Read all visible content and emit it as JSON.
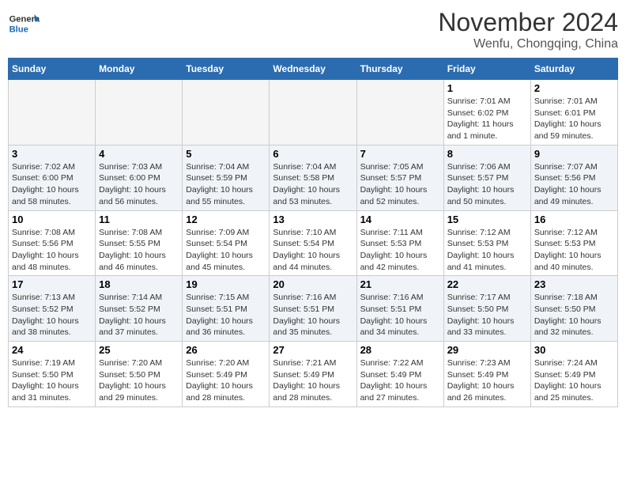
{
  "header": {
    "logo_general": "General",
    "logo_blue": "Blue",
    "month_title": "November 2024",
    "subtitle": "Wenfu, Chongqing, China"
  },
  "weekdays": [
    "Sunday",
    "Monday",
    "Tuesday",
    "Wednesday",
    "Thursday",
    "Friday",
    "Saturday"
  ],
  "weeks": [
    [
      {
        "day": "",
        "info": ""
      },
      {
        "day": "",
        "info": ""
      },
      {
        "day": "",
        "info": ""
      },
      {
        "day": "",
        "info": ""
      },
      {
        "day": "",
        "info": ""
      },
      {
        "day": "1",
        "info": "Sunrise: 7:01 AM\nSunset: 6:02 PM\nDaylight: 11 hours and 1 minute."
      },
      {
        "day": "2",
        "info": "Sunrise: 7:01 AM\nSunset: 6:01 PM\nDaylight: 10 hours and 59 minutes."
      }
    ],
    [
      {
        "day": "3",
        "info": "Sunrise: 7:02 AM\nSunset: 6:00 PM\nDaylight: 10 hours and 58 minutes."
      },
      {
        "day": "4",
        "info": "Sunrise: 7:03 AM\nSunset: 6:00 PM\nDaylight: 10 hours and 56 minutes."
      },
      {
        "day": "5",
        "info": "Sunrise: 7:04 AM\nSunset: 5:59 PM\nDaylight: 10 hours and 55 minutes."
      },
      {
        "day": "6",
        "info": "Sunrise: 7:04 AM\nSunset: 5:58 PM\nDaylight: 10 hours and 53 minutes."
      },
      {
        "day": "7",
        "info": "Sunrise: 7:05 AM\nSunset: 5:57 PM\nDaylight: 10 hours and 52 minutes."
      },
      {
        "day": "8",
        "info": "Sunrise: 7:06 AM\nSunset: 5:57 PM\nDaylight: 10 hours and 50 minutes."
      },
      {
        "day": "9",
        "info": "Sunrise: 7:07 AM\nSunset: 5:56 PM\nDaylight: 10 hours and 49 minutes."
      }
    ],
    [
      {
        "day": "10",
        "info": "Sunrise: 7:08 AM\nSunset: 5:56 PM\nDaylight: 10 hours and 48 minutes."
      },
      {
        "day": "11",
        "info": "Sunrise: 7:08 AM\nSunset: 5:55 PM\nDaylight: 10 hours and 46 minutes."
      },
      {
        "day": "12",
        "info": "Sunrise: 7:09 AM\nSunset: 5:54 PM\nDaylight: 10 hours and 45 minutes."
      },
      {
        "day": "13",
        "info": "Sunrise: 7:10 AM\nSunset: 5:54 PM\nDaylight: 10 hours and 44 minutes."
      },
      {
        "day": "14",
        "info": "Sunrise: 7:11 AM\nSunset: 5:53 PM\nDaylight: 10 hours and 42 minutes."
      },
      {
        "day": "15",
        "info": "Sunrise: 7:12 AM\nSunset: 5:53 PM\nDaylight: 10 hours and 41 minutes."
      },
      {
        "day": "16",
        "info": "Sunrise: 7:12 AM\nSunset: 5:53 PM\nDaylight: 10 hours and 40 minutes."
      }
    ],
    [
      {
        "day": "17",
        "info": "Sunrise: 7:13 AM\nSunset: 5:52 PM\nDaylight: 10 hours and 38 minutes."
      },
      {
        "day": "18",
        "info": "Sunrise: 7:14 AM\nSunset: 5:52 PM\nDaylight: 10 hours and 37 minutes."
      },
      {
        "day": "19",
        "info": "Sunrise: 7:15 AM\nSunset: 5:51 PM\nDaylight: 10 hours and 36 minutes."
      },
      {
        "day": "20",
        "info": "Sunrise: 7:16 AM\nSunset: 5:51 PM\nDaylight: 10 hours and 35 minutes."
      },
      {
        "day": "21",
        "info": "Sunrise: 7:16 AM\nSunset: 5:51 PM\nDaylight: 10 hours and 34 minutes."
      },
      {
        "day": "22",
        "info": "Sunrise: 7:17 AM\nSunset: 5:50 PM\nDaylight: 10 hours and 33 minutes."
      },
      {
        "day": "23",
        "info": "Sunrise: 7:18 AM\nSunset: 5:50 PM\nDaylight: 10 hours and 32 minutes."
      }
    ],
    [
      {
        "day": "24",
        "info": "Sunrise: 7:19 AM\nSunset: 5:50 PM\nDaylight: 10 hours and 31 minutes."
      },
      {
        "day": "25",
        "info": "Sunrise: 7:20 AM\nSunset: 5:50 PM\nDaylight: 10 hours and 29 minutes."
      },
      {
        "day": "26",
        "info": "Sunrise: 7:20 AM\nSunset: 5:49 PM\nDaylight: 10 hours and 28 minutes."
      },
      {
        "day": "27",
        "info": "Sunrise: 7:21 AM\nSunset: 5:49 PM\nDaylight: 10 hours and 28 minutes."
      },
      {
        "day": "28",
        "info": "Sunrise: 7:22 AM\nSunset: 5:49 PM\nDaylight: 10 hours and 27 minutes."
      },
      {
        "day": "29",
        "info": "Sunrise: 7:23 AM\nSunset: 5:49 PM\nDaylight: 10 hours and 26 minutes."
      },
      {
        "day": "30",
        "info": "Sunrise: 7:24 AM\nSunset: 5:49 PM\nDaylight: 10 hours and 25 minutes."
      }
    ]
  ]
}
